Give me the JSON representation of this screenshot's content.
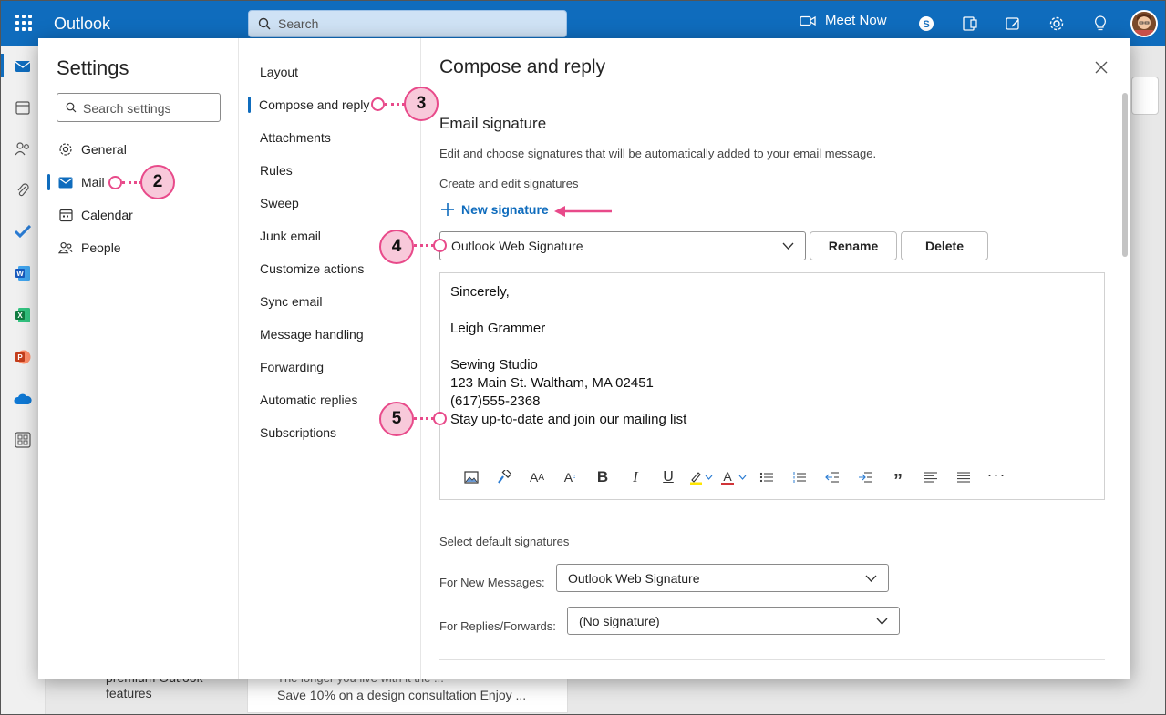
{
  "topbar": {
    "app_title": "Outlook",
    "search_placeholder": "Search",
    "meet_now": "Meet Now",
    "accent": "#0f6cbd"
  },
  "background": {
    "promo_line1": "premium Outlook",
    "promo_line2": "features",
    "message_line1": "The longer you live with it the ...",
    "message_line2": "Save 10% on a design consultation Enjoy ..."
  },
  "settings": {
    "title": "Settings",
    "search_placeholder": "Search settings",
    "categories": [
      {
        "label": "General",
        "icon": "gear-icon"
      },
      {
        "label": "Mail",
        "icon": "mail-icon",
        "selected": true
      },
      {
        "label": "Calendar",
        "icon": "calendar-icon"
      },
      {
        "label": "People",
        "icon": "people-icon"
      }
    ],
    "mail_sections": [
      {
        "label": "Layout"
      },
      {
        "label": "Compose and reply",
        "selected": true
      },
      {
        "label": "Attachments"
      },
      {
        "label": "Rules"
      },
      {
        "label": "Sweep"
      },
      {
        "label": "Junk email"
      },
      {
        "label": "Customize actions"
      },
      {
        "label": "Sync email"
      },
      {
        "label": "Message handling"
      },
      {
        "label": "Forwarding"
      },
      {
        "label": "Automatic replies"
      },
      {
        "label": "Subscriptions"
      }
    ]
  },
  "content": {
    "title": "Compose and reply",
    "section_title": "Email signature",
    "section_desc": "Edit and choose signatures that will be automatically added to your email message.",
    "create_label": "Create and edit signatures",
    "new_signature": "New signature",
    "signature_select": "Outlook Web Signature",
    "rename": "Rename",
    "delete": "Delete",
    "signature_lines": [
      "Sincerely,",
      "",
      "Leigh Grammer",
      "",
      "Sewing Studio",
      "123 Main St. Waltham, MA 02451",
      "(617)555-2368",
      "Stay up-to-date and join our mailing list"
    ],
    "default_label": "Select default signatures",
    "for_new_label": "For New Messages:",
    "for_new_value": "Outlook Web Signature",
    "for_replies_label": "For Replies/Forwards:",
    "for_replies_value": "(No signature)"
  },
  "callouts": {
    "mail": "2",
    "compose": "3",
    "signature_select": "4",
    "signature_body": "5",
    "color": "#e84a8a"
  }
}
